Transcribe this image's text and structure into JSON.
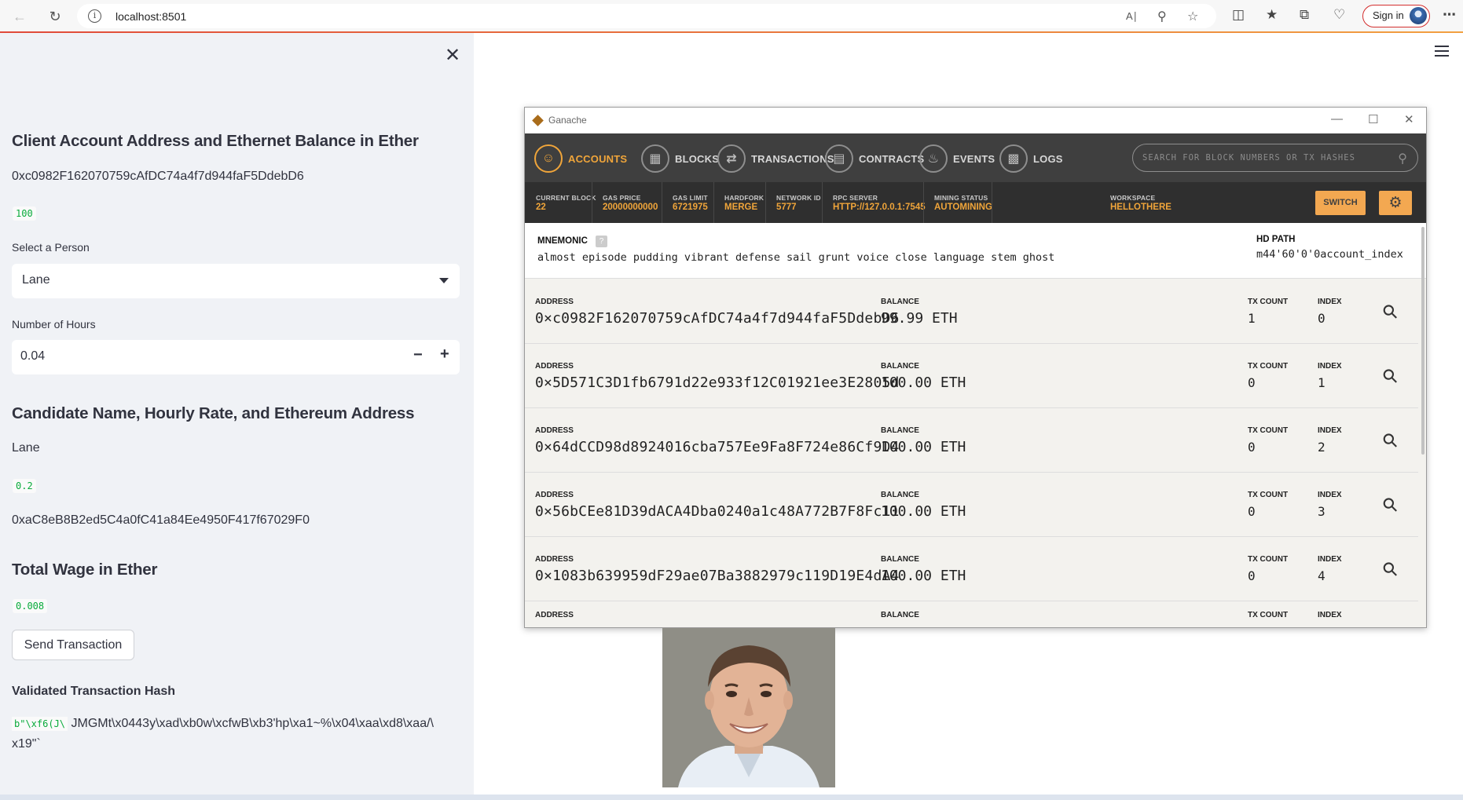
{
  "browser": {
    "url": "localhost:8501",
    "signin_label": "Sign in"
  },
  "sidebar": {
    "heading_client": "Client Account Address and Ethernet Balance in Ether",
    "client_address": "0xc0982F162070759cAfDC74a4f7d944faF5DdebD6",
    "client_balance": "100",
    "select_person_label": "Select a Person",
    "selected_person": "Lane",
    "hours_label": "Number of Hours",
    "hours_value": "0.04",
    "heading_candidate": "Candidate Name, Hourly Rate, and Ethereum Address",
    "candidate_name": "Lane",
    "candidate_rate": "0.2",
    "candidate_address": "0xaC8eB8B2ed5C4a0fC41a84Ee4950F417f67029F0",
    "heading_wage": "Total Wage in Ether",
    "total_wage": "0.008",
    "send_button": "Send Transaction",
    "heading_hash": "Validated Transaction Hash",
    "hash_code_prefix": "b\"\\xf6(J\\",
    "hash_rest_line1": "JMGMt\\x0443y\\xad\\xb0w\\xcfwB\\xb3'hp\\xa1~%\\x04\\xaa\\xd8\\xaa/\\",
    "hash_line2": "x19\"`"
  },
  "ganache": {
    "window_title": "Ganache",
    "tabs": {
      "accounts": "ACCOUNTS",
      "blocks": "BLOCKS",
      "transactions": "TRANSACTIONS",
      "contracts": "CONTRACTS",
      "events": "EVENTS",
      "logs": "LOGS"
    },
    "search_placeholder": "SEARCH FOR BLOCK NUMBERS OR TX HASHES",
    "status": {
      "current_block_label": "CURRENT BLOCK",
      "current_block": "22",
      "gas_price_label": "GAS PRICE",
      "gas_price": "20000000000",
      "gas_limit_label": "GAS LIMIT",
      "gas_limit": "6721975",
      "hardfork_label": "HARDFORK",
      "hardfork": "MERGE",
      "network_id_label": "NETWORK ID",
      "network_id": "5777",
      "rpc_server_label": "RPC SERVER",
      "rpc_server": "HTTP://127.0.0.1:7545",
      "mining_status_label": "MINING STATUS",
      "mining_status": "AUTOMINING",
      "workspace_label": "WORKSPACE",
      "workspace": "HELLOTHERE",
      "switch_label": "SWITCH"
    },
    "mnemonic_label": "MNEMONIC",
    "mnemonic_help": "?",
    "mnemonic": "almost episode pudding vibrant defense sail grunt voice close language stem ghost",
    "hd_path_label": "HD PATH",
    "hd_path": "m44'60'0'0account_index",
    "labels": {
      "address": "ADDRESS",
      "balance": "BALANCE",
      "tx_count": "TX COUNT",
      "index": "INDEX"
    },
    "accounts": [
      {
        "address": "0×c0982F162070759cAfDC74a4f7d944faF5DdebD6",
        "balance": "99.99 ETH",
        "tx_count": "1",
        "index": "0"
      },
      {
        "address": "0×5D571C3D1fb6791d22e933f12C01921ee3E2805d",
        "balance": "100.00 ETH",
        "tx_count": "0",
        "index": "1"
      },
      {
        "address": "0×64dCCD98d8924016cba757Ee9Fa8F724e86Cf9D4",
        "balance": "100.00 ETH",
        "tx_count": "0",
        "index": "2"
      },
      {
        "address": "0×56bCEe81D39dACA4Dba0240a1c48A772B7F8Fc11",
        "balance": "100.00 ETH",
        "tx_count": "0",
        "index": "3"
      },
      {
        "address": "0×1083b639959dF29ae07Ba3882979c119D19E4dA4",
        "balance": "100.00 ETH",
        "tx_count": "0",
        "index": "4"
      }
    ]
  }
}
